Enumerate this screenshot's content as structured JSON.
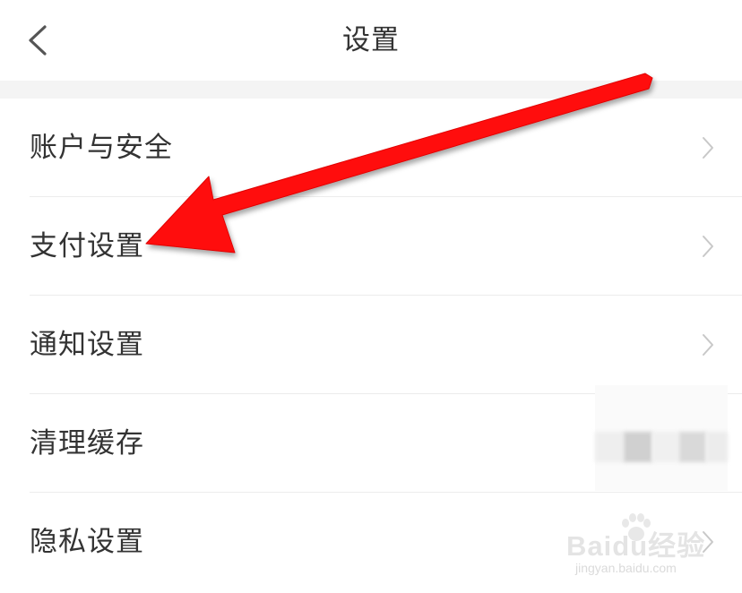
{
  "header": {
    "title": "设置",
    "back_icon": "chevron-left-icon"
  },
  "settings": {
    "items": [
      {
        "label": "账户与安全",
        "icon": "chevron-right-icon"
      },
      {
        "label": "支付设置",
        "icon": "chevron-right-icon"
      },
      {
        "label": "通知设置",
        "icon": "chevron-right-icon"
      },
      {
        "label": "清理缓存",
        "value_obscured": true
      },
      {
        "label": "隐私设置",
        "icon": "chevron-right-icon"
      }
    ]
  },
  "annotation": {
    "arrow_color": "#ff1010",
    "target": "支付设置"
  },
  "watermark": {
    "brand": "Baidu经验",
    "url": "jingyan.baidu.com"
  },
  "colors": {
    "text": "#333333",
    "chevron": "#c8c8c8",
    "divider": "#ececec",
    "section_gap": "#f4f4f4"
  }
}
